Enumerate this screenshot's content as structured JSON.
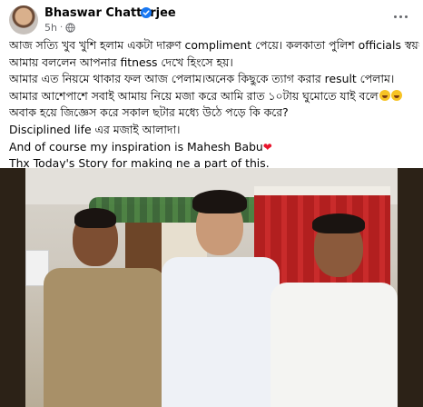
{
  "post": {
    "author": "Bhaswar Chatterjee",
    "time": "5h",
    "dot": "·",
    "icons": {
      "verified": "verified-badge-icon",
      "audience": "globe-icon",
      "more": "more-options-icon"
    }
  },
  "text": {
    "line1": "আজ সত্যি খুব খুশি হলাম একটা দারুণ compliment পেয়ে। কলকাতা পুলিশ officials স্বয়ং",
    "line2": "আমায় বললেন আপনার fitness দেখে হিংসে হয়।",
    "line3": "আমার এত নিয়মে থাকার ফল আজ পেলাম।অনেক কিছুকে ত্যাগ করার result পেলাম।",
    "line4": "আমার আশেপাশে সবাই আমায় নিয়ে মজা করে আমি রাত ১০টায় ঘুমোতে যাই বলে",
    "line5": "অবাক হয়ে জিজ্ঞেস করে সকাল ছটার মধ্যে  উঠে পড়ে কি করে?",
    "line6": "Disciplined life এর মজাই আলাদা।",
    "line7": "And of course my inspiration is Mahesh Babu",
    "line8": "Thx Today's Story for making ne a part of this."
  },
  "emoji": [
    "laughing-emoji-icon",
    "laughing-emoji-icon",
    "red-heart-icon"
  ],
  "colors": {
    "text": "#050505",
    "secondary": "#65676b",
    "verified": "#1877f2",
    "heart": "#e8142c"
  }
}
